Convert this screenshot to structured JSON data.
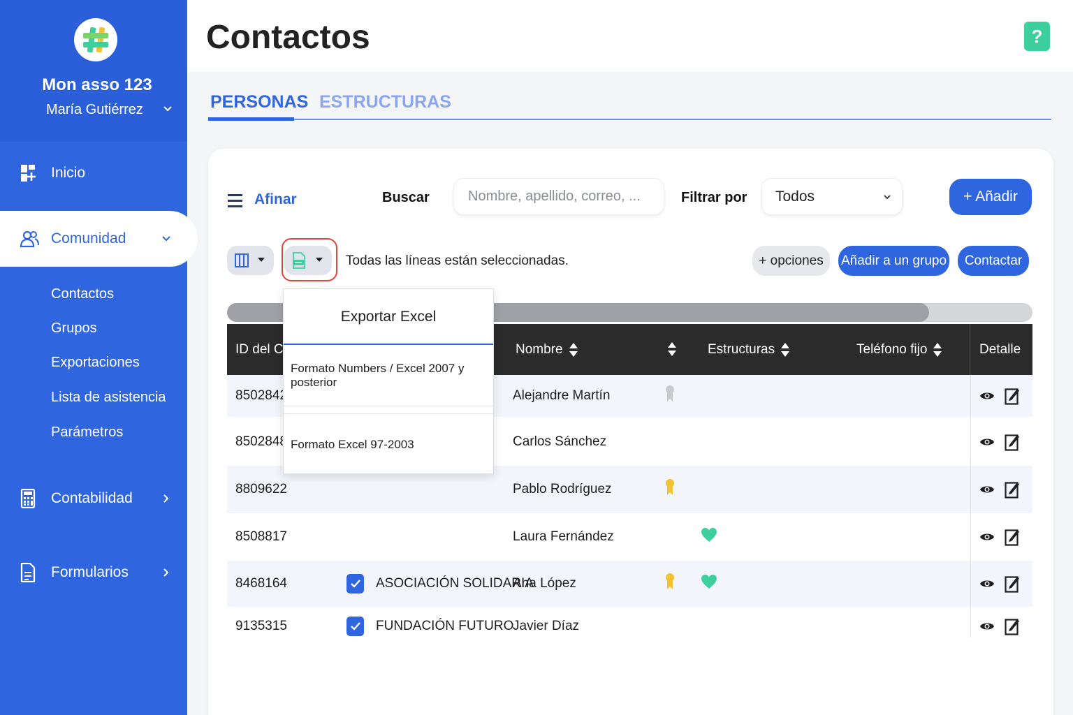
{
  "sidebar": {
    "org_name": "Mon asso 123",
    "user_name": "María Gutiérrez",
    "nav": {
      "inicio": "Inicio",
      "comunidad": "Comunidad",
      "contabilidad": "Contabilidad",
      "formularios": "Formularios"
    },
    "submenu": [
      "Contactos",
      "Grupos",
      "Exportaciones",
      "Lista de asistencia",
      "Parámetros"
    ]
  },
  "header": {
    "title": "Contactos",
    "help": "?"
  },
  "tabs": {
    "personas": "PERSONAS",
    "estructuras": "ESTRUCTURAS"
  },
  "toolbar": {
    "afinar": "Afinar",
    "buscar_label": "Buscar",
    "search_placeholder": "Nombre, apellido, correo, ...",
    "filter_label": "Filtrar por",
    "filter_value": "Todos",
    "add_label": "+ Añadir",
    "selection_text": "Todas las líneas están seleccionadas.",
    "options_label": "+ opciones",
    "add_group_label": "Añadir a un grupo",
    "contact_label": "Contactar"
  },
  "export_menu": {
    "title": "Exportar Excel",
    "items": [
      "Formato Numbers / Excel 2007 y posterior",
      "Formato Excel 97-2003"
    ]
  },
  "table": {
    "headers": {
      "id": "ID del Co",
      "nombre": "Nombre",
      "estructuras": "Estructuras",
      "telefono": "Teléfono fijo",
      "detalle": "Detalle"
    },
    "rows": [
      {
        "id": "8502842",
        "estructura": "",
        "nombre": "Alejandre Martín",
        "badge": "silver",
        "heart": false,
        "checked": false
      },
      {
        "id": "8502848",
        "estructura": "",
        "nombre": "Carlos Sánchez",
        "badge": "",
        "heart": false,
        "checked": false
      },
      {
        "id": "8809622",
        "estructura": "",
        "nombre": "Pablo Rodríguez",
        "badge": "gold",
        "heart": false,
        "checked": false
      },
      {
        "id": "8508817",
        "estructura": "",
        "nombre": "Laura Fernández",
        "badge": "",
        "heart": true,
        "checked": false
      },
      {
        "id": "8468164",
        "estructura": "ASOCIACIÓN SOLIDARIA",
        "nombre": "Ana López",
        "badge": "gold",
        "heart": true,
        "checked": true
      },
      {
        "id": "9135315",
        "estructura": "FUNDACIÓN FUTURO",
        "nombre": "Javier Díaz",
        "badge": "",
        "heart": false,
        "checked": true
      }
    ]
  },
  "colors": {
    "primary": "#2f66e0",
    "accent_green": "#3ecf9e",
    "highlight_red": "#e3443a",
    "table_header": "#2b2b2b"
  }
}
